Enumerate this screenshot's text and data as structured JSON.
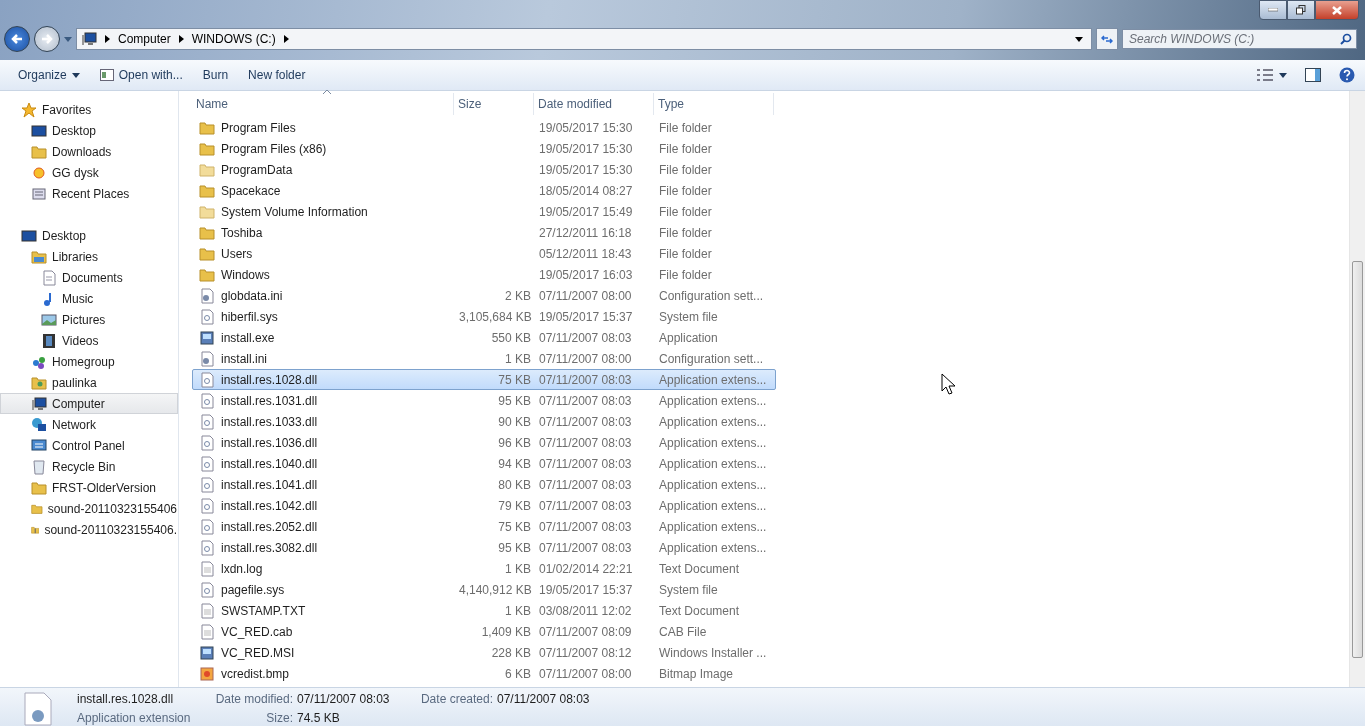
{
  "address": {
    "crumbs": [
      "Computer",
      "WINDOWS (C:)"
    ]
  },
  "search": {
    "placeholder": "Search WINDOWS (C:)"
  },
  "toolbar": [
    {
      "label": "Organize",
      "kind": "menu"
    },
    {
      "label": "Open with...",
      "kind": "open"
    },
    {
      "label": "Burn",
      "kind": "plain"
    },
    {
      "label": "New folder",
      "kind": "plain"
    }
  ],
  "sidebar": {
    "items": [
      {
        "label": "Favorites",
        "kind": "star",
        "selected": false,
        "children": [
          {
            "label": "Desktop",
            "kind": "desktop",
            "selected": false
          },
          {
            "label": "Downloads",
            "kind": "folder",
            "selected": false
          },
          {
            "label": "GG dysk",
            "kind": "sun",
            "selected": false
          },
          {
            "label": "Recent Places",
            "kind": "recent",
            "selected": false
          }
        ]
      },
      {
        "label": "Desktop",
        "kind": "desktop",
        "selected": false,
        "children": [
          {
            "label": "Libraries",
            "kind": "library",
            "selected": false,
            "children": [
              {
                "label": "Documents",
                "kind": "doc",
                "selected": false
              },
              {
                "label": "Music",
                "kind": "music",
                "selected": false
              },
              {
                "label": "Pictures",
                "kind": "picture",
                "selected": false
              },
              {
                "label": "Videos",
                "kind": "video",
                "selected": false
              }
            ]
          },
          {
            "label": "Homegroup",
            "kind": "homegroup",
            "selected": false
          },
          {
            "label": "paulinka",
            "kind": "user",
            "selected": false
          },
          {
            "label": "Computer",
            "kind": "computer",
            "selected": true
          },
          {
            "label": "Network",
            "kind": "network",
            "selected": false
          },
          {
            "label": "Control Panel",
            "kind": "control",
            "selected": false
          },
          {
            "label": "Recycle Bin",
            "kind": "bin",
            "selected": false
          },
          {
            "label": "FRST-OlderVersion",
            "kind": "folder",
            "selected": false
          },
          {
            "label": "sound-20110323155406",
            "kind": "folder",
            "selected": false
          },
          {
            "label": "sound-20110323155406.",
            "kind": "zip",
            "selected": false
          }
        ]
      }
    ]
  },
  "table": {
    "columns": [
      {
        "label": "Name",
        "sorted": true
      },
      {
        "label": "Size",
        "sorted": false
      },
      {
        "label": "Date modified",
        "sorted": false
      },
      {
        "label": "Type",
        "sorted": false
      }
    ],
    "rows": [
      {
        "name": "Program Files",
        "size": "",
        "date": "19/05/2017 15:30",
        "type": "File folder",
        "kind": "folder",
        "selected": false
      },
      {
        "name": "Program Files (x86)",
        "size": "",
        "date": "19/05/2017 15:30",
        "type": "File folder",
        "kind": "folder",
        "selected": false
      },
      {
        "name": "ProgramData",
        "size": "",
        "date": "19/05/2017 15:30",
        "type": "File folder",
        "kind": "folder-pale",
        "selected": false
      },
      {
        "name": "Spacekace",
        "size": "",
        "date": "18/05/2014 08:27",
        "type": "File folder",
        "kind": "folder",
        "selected": false
      },
      {
        "name": "System Volume Information",
        "size": "",
        "date": "19/05/2017 15:49",
        "type": "File folder",
        "kind": "folder-pale",
        "selected": false
      },
      {
        "name": "Toshiba",
        "size": "",
        "date": "27/12/2011 16:18",
        "type": "File folder",
        "kind": "folder",
        "selected": false
      },
      {
        "name": "Users",
        "size": "",
        "date": "05/12/2011 18:43",
        "type": "File folder",
        "kind": "folder",
        "selected": false
      },
      {
        "name": "Windows",
        "size": "",
        "date": "19/05/2017 16:03",
        "type": "File folder",
        "kind": "folder",
        "selected": false
      },
      {
        "name": "globdata.ini",
        "size": "2 KB",
        "date": "07/11/2007 08:00",
        "type": "Configuration sett...",
        "kind": "config",
        "selected": false
      },
      {
        "name": "hiberfil.sys",
        "size": "3,105,684 KB",
        "date": "19/05/2017 15:37",
        "type": "System file",
        "kind": "system",
        "selected": false
      },
      {
        "name": "install.exe",
        "size": "550 KB",
        "date": "07/11/2007 08:03",
        "type": "Application",
        "kind": "app",
        "selected": false
      },
      {
        "name": "install.ini",
        "size": "1 KB",
        "date": "07/11/2007 08:00",
        "type": "Configuration sett...",
        "kind": "config",
        "selected": false
      },
      {
        "name": "install.res.1028.dll",
        "size": "75 KB",
        "date": "07/11/2007 08:03",
        "type": "Application extens...",
        "kind": "system",
        "selected": true
      },
      {
        "name": "install.res.1031.dll",
        "size": "95 KB",
        "date": "07/11/2007 08:03",
        "type": "Application extens...",
        "kind": "system",
        "selected": false
      },
      {
        "name": "install.res.1033.dll",
        "size": "90 KB",
        "date": "07/11/2007 08:03",
        "type": "Application extens...",
        "kind": "system",
        "selected": false
      },
      {
        "name": "install.res.1036.dll",
        "size": "96 KB",
        "date": "07/11/2007 08:03",
        "type": "Application extens...",
        "kind": "system",
        "selected": false
      },
      {
        "name": "install.res.1040.dll",
        "size": "94 KB",
        "date": "07/11/2007 08:03",
        "type": "Application extens...",
        "kind": "system",
        "selected": false
      },
      {
        "name": "install.res.1041.dll",
        "size": "80 KB",
        "date": "07/11/2007 08:03",
        "type": "Application extens...",
        "kind": "system",
        "selected": false
      },
      {
        "name": "install.res.1042.dll",
        "size": "79 KB",
        "date": "07/11/2007 08:03",
        "type": "Application extens...",
        "kind": "system",
        "selected": false
      },
      {
        "name": "install.res.2052.dll",
        "size": "75 KB",
        "date": "07/11/2007 08:03",
        "type": "Application extens...",
        "kind": "system",
        "selected": false
      },
      {
        "name": "install.res.3082.dll",
        "size": "95 KB",
        "date": "07/11/2007 08:03",
        "type": "Application extens...",
        "kind": "system",
        "selected": false
      },
      {
        "name": "lxdn.log",
        "size": "1 KB",
        "date": "01/02/2014 22:21",
        "type": "Text Document",
        "kind": "text",
        "selected": false
      },
      {
        "name": "pagefile.sys",
        "size": "4,140,912 KB",
        "date": "19/05/2017 15:37",
        "type": "System file",
        "kind": "system",
        "selected": false
      },
      {
        "name": "SWSTAMP.TXT",
        "size": "1 KB",
        "date": "03/08/2011 12:02",
        "type": "Text Document",
        "kind": "text",
        "selected": false
      },
      {
        "name": "VC_RED.cab",
        "size": "1,409 KB",
        "date": "07/11/2007 08:09",
        "type": "CAB File",
        "kind": "text",
        "selected": false
      },
      {
        "name": "VC_RED.MSI",
        "size": "228 KB",
        "date": "07/11/2007 08:12",
        "type": "Windows Installer ...",
        "kind": "app",
        "selected": false
      },
      {
        "name": "vcredist.bmp",
        "size": "6 KB",
        "date": "07/11/2007 08:00",
        "type": "Bitmap Image",
        "kind": "bmp",
        "selected": false
      }
    ]
  },
  "details": {
    "name": "install.res.1028.dll",
    "type": "Application extension",
    "fields": [
      {
        "label": "Date modified:",
        "value": "07/11/2007 08:03"
      },
      {
        "label": "Size:",
        "value": "74.5 KB"
      },
      {
        "label": "Date created:",
        "value": "07/11/2007 08:03"
      }
    ]
  }
}
